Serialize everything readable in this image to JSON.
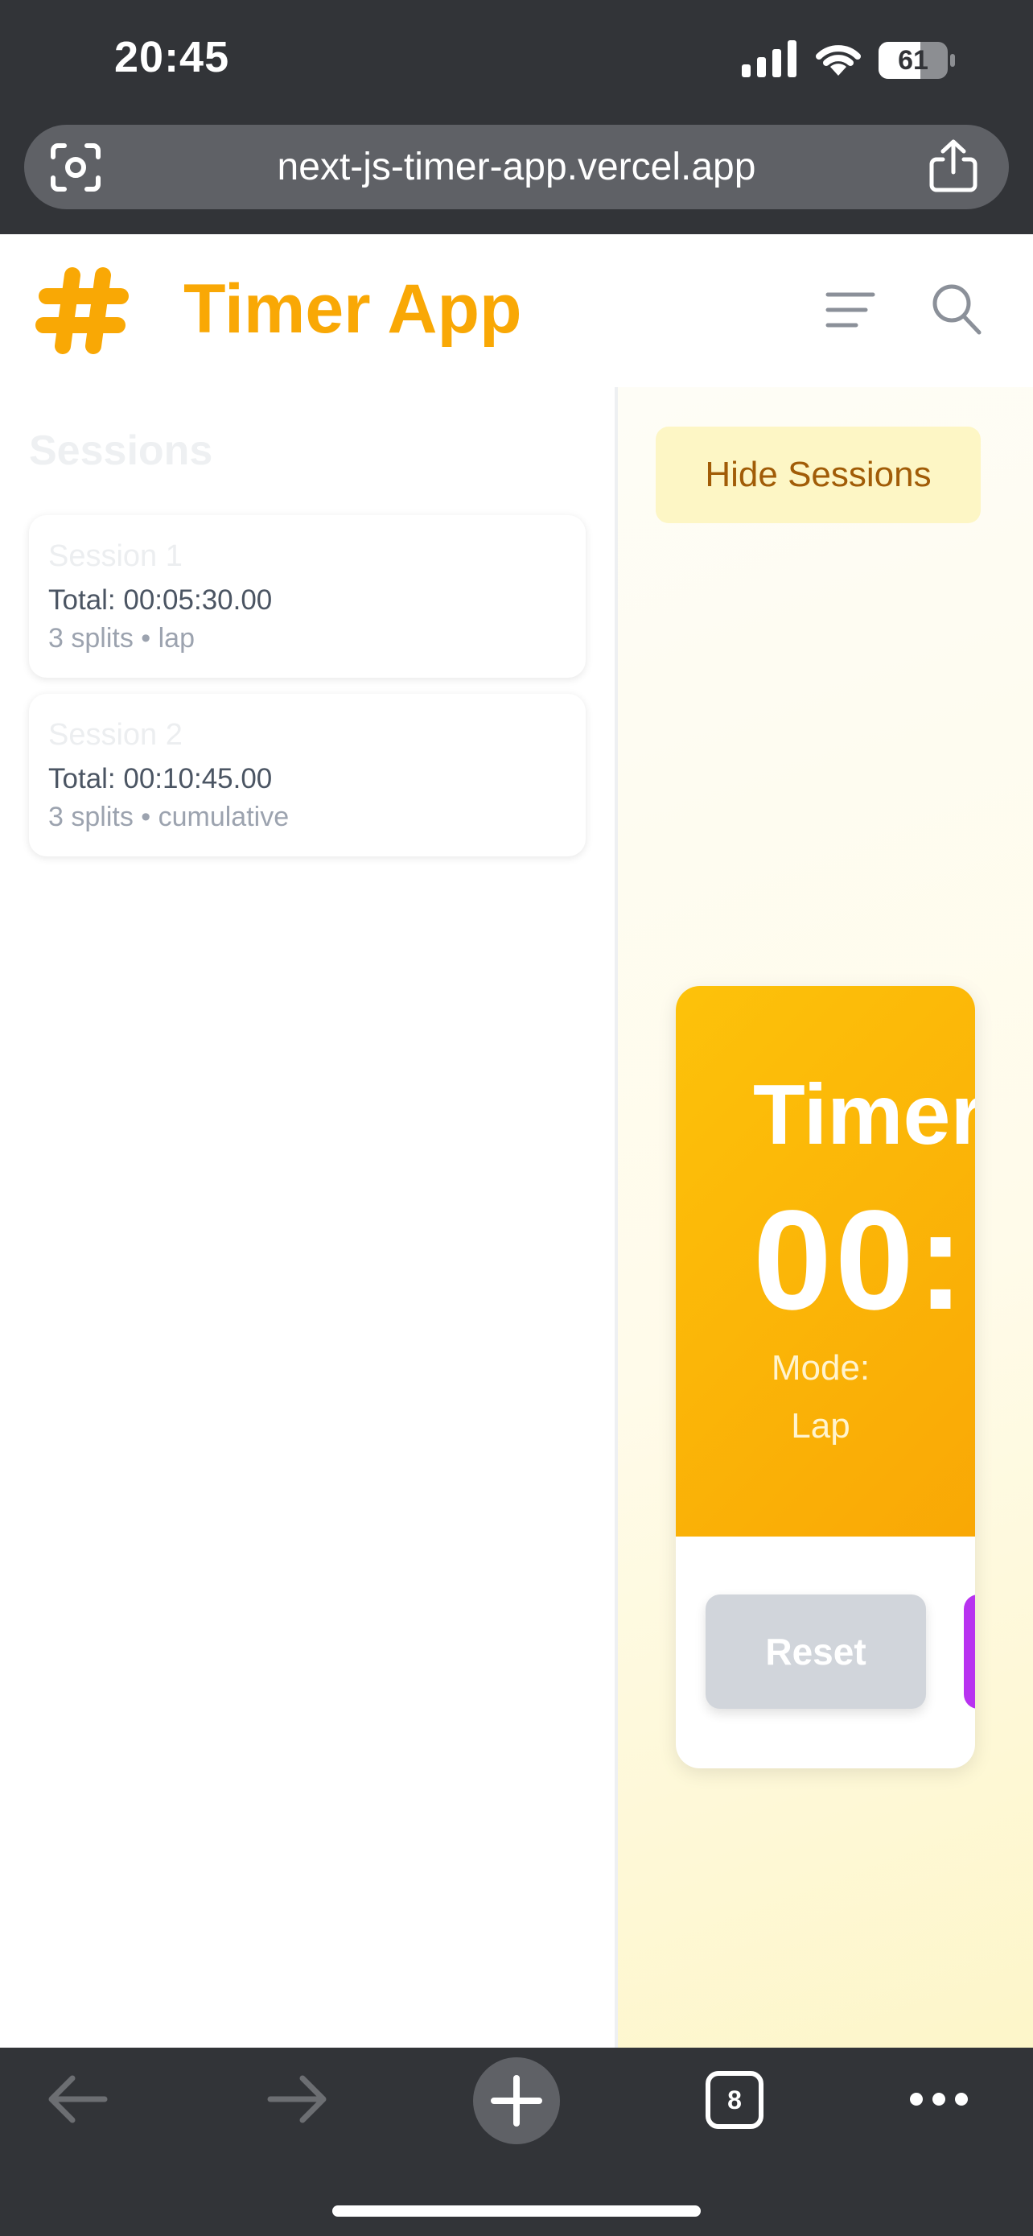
{
  "status_bar": {
    "time": "20:45",
    "battery": "61"
  },
  "browser": {
    "url": "next-js-timer-app.vercel.app",
    "tab_count": "8"
  },
  "header": {
    "title": "Timer App"
  },
  "sidebar": {
    "title": "Sessions",
    "sessions": [
      {
        "name": "Session 1",
        "total": "Total: 00:05:30.00",
        "meta": "3 splits • lap"
      },
      {
        "name": "Session 2",
        "total": "Total: 00:10:45.00",
        "meta": "3 splits • cumulative"
      }
    ]
  },
  "main": {
    "hide_sessions_label": "Hide Sessions",
    "timer": {
      "heading": "Timer",
      "display": "00:",
      "mode_label": "Mode:",
      "mode_value": "Lap"
    },
    "reset_label": "Reset"
  },
  "colors": {
    "accent": "#f9a805",
    "chrome": "#323438",
    "purple_button": "#b832f0"
  },
  "icons": [
    "camera-lens-icon",
    "share-icon",
    "hash-logo-icon",
    "menu-icon",
    "search-icon",
    "back-arrow-icon",
    "forward-arrow-icon",
    "plus-icon",
    "more-icon"
  ]
}
